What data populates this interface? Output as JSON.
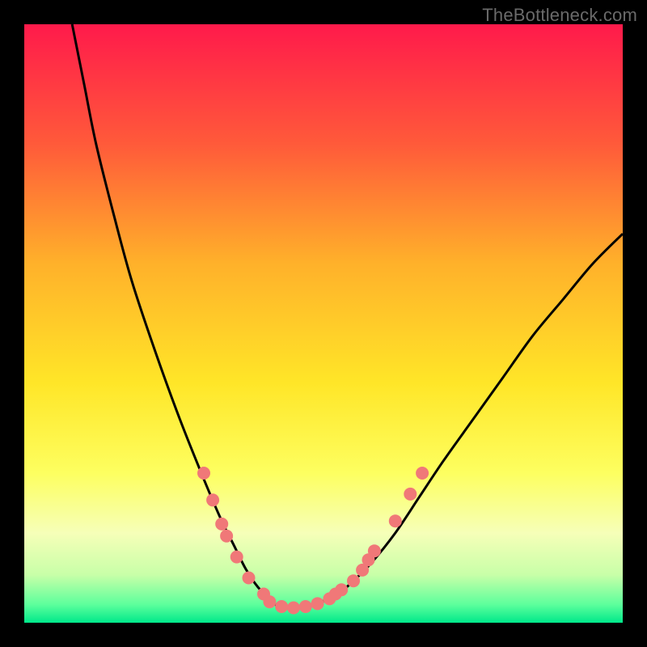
{
  "watermark": "TheBottleneck.com",
  "chart_data": {
    "type": "line",
    "title": "",
    "xlabel": "",
    "ylabel": "",
    "xlim": [
      0,
      100
    ],
    "ylim": [
      0,
      100
    ],
    "gradient_stops": [
      {
        "offset": 0.0,
        "color": "#ff1a4b"
      },
      {
        "offset": 0.2,
        "color": "#ff5a3a"
      },
      {
        "offset": 0.4,
        "color": "#ffb12a"
      },
      {
        "offset": 0.6,
        "color": "#ffe628"
      },
      {
        "offset": 0.75,
        "color": "#fdff60"
      },
      {
        "offset": 0.85,
        "color": "#f6ffb8"
      },
      {
        "offset": 0.92,
        "color": "#c8ffa8"
      },
      {
        "offset": 0.97,
        "color": "#5cff9c"
      },
      {
        "offset": 1.0,
        "color": "#00e88a"
      }
    ],
    "series": [
      {
        "name": "curve",
        "x": [
          8,
          10,
          12,
          15,
          18,
          22,
          26,
          30,
          33,
          35,
          37,
          39,
          41,
          42,
          43,
          45,
          48,
          52,
          55,
          58,
          62,
          66,
          70,
          75,
          80,
          85,
          90,
          95,
          100
        ],
        "y": [
          100,
          90,
          80,
          68,
          57,
          45,
          34,
          24,
          17,
          13,
          9,
          6,
          4,
          3,
          2.5,
          2.5,
          3,
          4.5,
          7,
          10,
          15,
          21,
          27,
          34,
          41,
          48,
          54,
          60,
          65
        ]
      }
    ],
    "dots": {
      "name": "benchmark-points",
      "color": "#f07878",
      "radius": 8,
      "points": [
        {
          "x": 30.0,
          "y": 25.0
        },
        {
          "x": 31.5,
          "y": 20.5
        },
        {
          "x": 33.0,
          "y": 16.5
        },
        {
          "x": 33.8,
          "y": 14.5
        },
        {
          "x": 35.5,
          "y": 11.0
        },
        {
          "x": 37.5,
          "y": 7.5
        },
        {
          "x": 40.0,
          "y": 4.8
        },
        {
          "x": 41.0,
          "y": 3.5
        },
        {
          "x": 43.0,
          "y": 2.7
        },
        {
          "x": 45.0,
          "y": 2.5
        },
        {
          "x": 47.0,
          "y": 2.7
        },
        {
          "x": 49.0,
          "y": 3.2
        },
        {
          "x": 51.0,
          "y": 4.0
        },
        {
          "x": 52.0,
          "y": 4.8
        },
        {
          "x": 53.0,
          "y": 5.5
        },
        {
          "x": 55.0,
          "y": 7.0
        },
        {
          "x": 56.5,
          "y": 8.8
        },
        {
          "x": 57.5,
          "y": 10.5
        },
        {
          "x": 58.5,
          "y": 12.0
        },
        {
          "x": 62.0,
          "y": 17.0
        },
        {
          "x": 64.5,
          "y": 21.5
        },
        {
          "x": 66.5,
          "y": 25.0
        }
      ]
    }
  }
}
